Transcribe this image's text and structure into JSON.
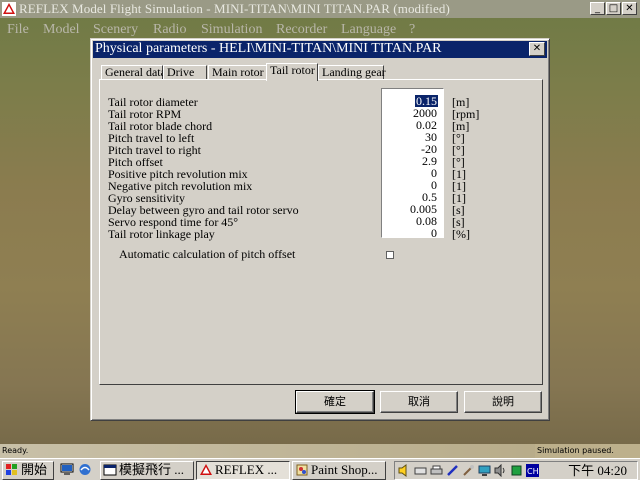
{
  "app": {
    "title": "REFLEX Model Flight Simulation - MINI-TITAN\\MINI TITAN.PAR (modified)",
    "menu": [
      "File",
      "Model",
      "Scenery",
      "Radio",
      "Simulation",
      "Recorder",
      "Language",
      "?"
    ]
  },
  "dialog": {
    "title": "Physical parameters - HELI\\MINI-TITAN\\MINI TITAN.PAR",
    "tabs": [
      "General data",
      "Drive",
      "Main rotor",
      "Tail rotor",
      "Landing gear"
    ],
    "active_tab": "Tail rotor",
    "params": [
      {
        "label": "Tail rotor diameter",
        "value": "0.15",
        "unit": "[m]"
      },
      {
        "label": "Tail rotor RPM",
        "value": "2000",
        "unit": "[rpm]"
      },
      {
        "label": "Tail rotor blade chord",
        "value": "0.02",
        "unit": "[m]"
      },
      {
        "label": "Pitch travel to left",
        "value": "30",
        "unit": "[°]"
      },
      {
        "label": "Pitch travel to right",
        "value": "-20",
        "unit": "[°]"
      },
      {
        "label": "Pitch offset",
        "value": "2.9",
        "unit": "[°]"
      },
      {
        "label": "Positive pitch revolution mix",
        "value": "0",
        "unit": "[1]"
      },
      {
        "label": "Negative pitch revolution mix",
        "value": "0",
        "unit": "[1]"
      },
      {
        "label": "Gyro sensitivity",
        "value": "0.5",
        "unit": "[1]"
      },
      {
        "label": "Delay between gyro and tail rotor servo",
        "value": "0.005",
        "unit": "[s]"
      },
      {
        "label": "Servo respond time for 45°",
        "value": "0.08",
        "unit": "[s]"
      },
      {
        "label": "Tail rotor linkage play",
        "value": "0",
        "unit": "[%]"
      }
    ],
    "auto_calc_label": "Automatic calculation of pitch offset",
    "auto_calc_checked": false,
    "buttons": {
      "ok": "確定",
      "cancel": "取消",
      "help": "說明"
    }
  },
  "status": {
    "left": "Ready.",
    "right": "Simulation paused."
  },
  "taskbar": {
    "start": "開始",
    "tasks": [
      "模擬飛行 ...",
      "REFLEX ...",
      "Paint Shop..."
    ],
    "clock": "下午 04:20"
  },
  "colors": {
    "title_active": "#0a246a",
    "face": "#d4d0c8"
  }
}
